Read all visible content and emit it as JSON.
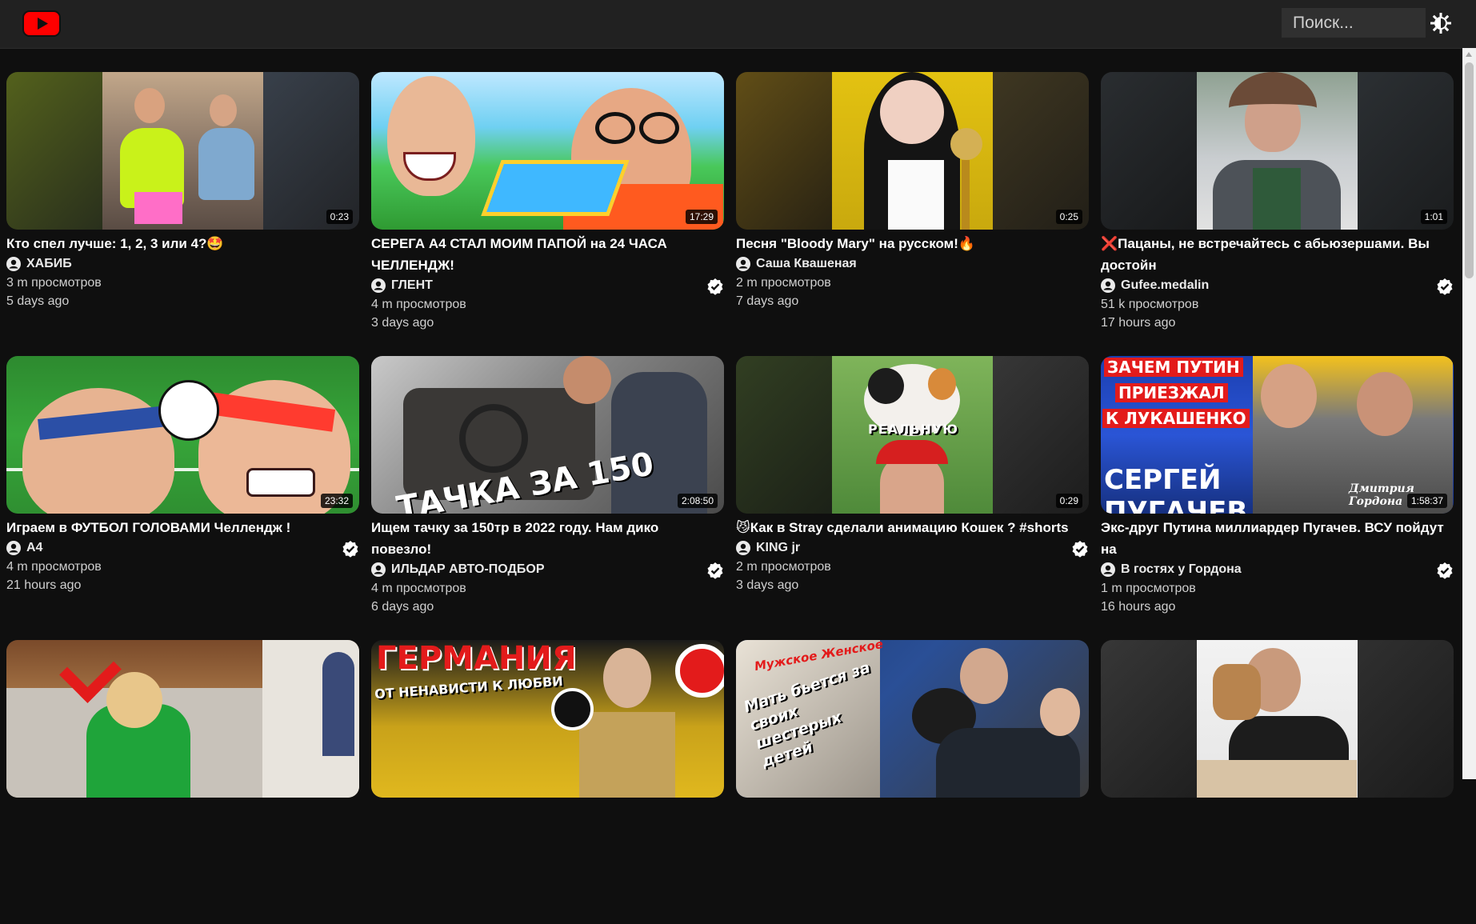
{
  "header": {
    "search_placeholder": "Поиск..."
  },
  "videos": [
    {
      "title": "Кто спел лучше: 1, 2, 3 или 4?🤩",
      "channel": "ХАБИБ",
      "views": "3 m просмотров",
      "age": "5 days ago",
      "duration": "0:23",
      "verified": false
    },
    {
      "title": "СЕРЕГА А4 СТАЛ МОИМ ПАПОЙ на 24 ЧАСА ЧЕЛЛЕНДЖ!",
      "channel": "ГЛЕНТ",
      "views": "4 m просмотров",
      "age": "3 days ago",
      "duration": "17:29",
      "verified": true
    },
    {
      "title": "Песня \"Bloody Mary\" на русском!🔥",
      "channel": "Саша Квашеная",
      "views": "2 m просмотров",
      "age": "7 days ago",
      "duration": "0:25",
      "verified": false
    },
    {
      "title": "❌Пацаны, не встречайтесь с абьюзершами. Вы достойн",
      "channel": "Gufee.medalin",
      "views": "51 k просмотров",
      "age": "17 hours ago",
      "duration": "1:01",
      "verified": true
    },
    {
      "title": "Играем в ФУТБОЛ ГОЛОВАМИ Челлендж !",
      "channel": "A4",
      "views": "4 m просмотров",
      "age": "21 hours ago",
      "duration": "23:32",
      "verified": true
    },
    {
      "title": "Ищем тачку за 150тр в 2022 году. Нам дико повезло!",
      "channel": "ИЛЬДАР АВТО-ПОДБОР",
      "views": "4 m просмотров",
      "age": "6 days ago",
      "duration": "2:08:50",
      "verified": true
    },
    {
      "title": "😼Как в Stray сделали анимацию Кошек ? #shorts",
      "channel": "KING jr",
      "views": "2 m просмотров",
      "age": "3 days ago",
      "duration": "0:29",
      "verified": true
    },
    {
      "title": "Экс-друг Путина миллиардер Пугачев. ВСУ пойдут на",
      "channel": "В гостях у Гордона",
      "views": "1 m просмотров",
      "age": "16 hours ago",
      "duration": "1:58:37",
      "verified": true
    },
    {
      "title": "",
      "channel": "",
      "views": "",
      "age": "",
      "duration": "",
      "verified": false
    },
    {
      "title": "",
      "channel": "",
      "views": "",
      "age": "",
      "duration": "",
      "verified": false
    },
    {
      "title": "",
      "channel": "",
      "views": "",
      "age": "",
      "duration": "",
      "verified": false
    },
    {
      "title": "",
      "channel": "",
      "views": "",
      "age": "",
      "duration": "",
      "verified": false
    }
  ],
  "thumb_text": {
    "card6_overlay": "ТАЧКА ЗА 150",
    "card7_overlay": "РЕАЛЬНУЮ",
    "card8_overlay_1": "ЗАЧЕМ ПУТИН",
    "card8_overlay_2": "ПРИЕЗЖАЛ",
    "card8_overlay_3": "К ЛУКАШЕНКО",
    "card8_overlay_4": "СЕРГЕЙ",
    "card8_overlay_5": "ПУГАЧЕВ",
    "card8_overlay_6": "Дмитрия Гордона",
    "card10_overlay_1": "ГЕРМАНИЯ",
    "card10_overlay_2": "ОТ НЕНАВИСТИ К ЛЮБВИ",
    "card11_overlay_1": "Мужское Женское",
    "card11_overlay_2": "Мать бьется за своих шестерых детей"
  },
  "colors": {
    "background": "#0f0f0f",
    "topbar": "#212121",
    "search_bg": "#303030",
    "logo_red": "#ff0000"
  }
}
